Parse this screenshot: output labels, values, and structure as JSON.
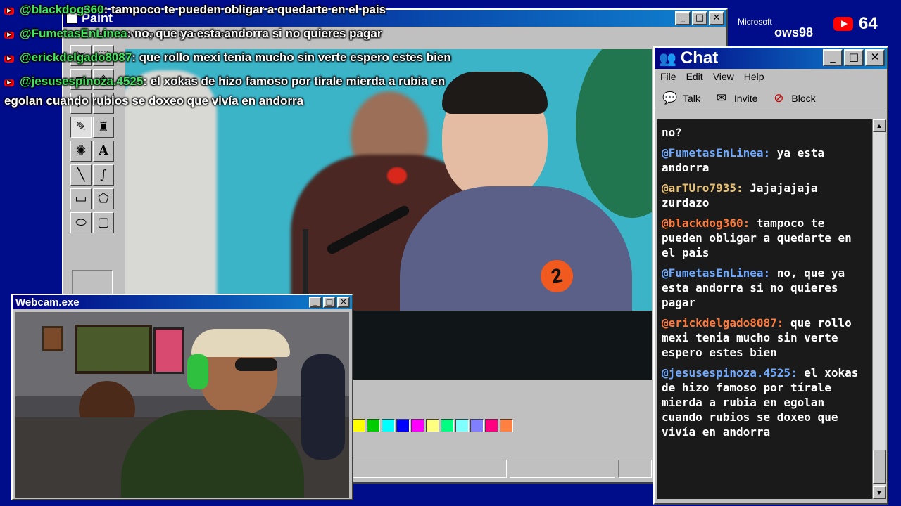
{
  "paint": {
    "title": "Paint",
    "menu": [
      "File",
      "Edit",
      "View",
      "Image",
      "Colors",
      "Help"
    ],
    "palette": [
      "#ffff00",
      "#00cc00",
      "#00ffff",
      "#0000ff",
      "#ff00ff",
      "#ffff80",
      "#00ff80",
      "#80ffff",
      "#8080ff",
      "#ff0080",
      "#ff8040"
    ]
  },
  "chat": {
    "title": "Chat",
    "menu": [
      "File",
      "Edit",
      "View",
      "Help"
    ],
    "tools": {
      "talk": "Talk",
      "invite": "Invite",
      "block": "Block"
    },
    "messages": [
      {
        "user": "",
        "text": "no?",
        "color": "#ffffff"
      },
      {
        "user": "@FumetasEnLinea:",
        "text": " ya esta andorra",
        "color": "#6fa8ff"
      },
      {
        "user": "@arTUro7935:",
        "text": " Jajajajaja zurdazo",
        "color": "#e8c070"
      },
      {
        "user": "@blackdog360:",
        "text": " tampoco te pueden obligar a quedarte en el pais",
        "color": "#ff7a3a"
      },
      {
        "user": "@FumetasEnLinea:",
        "text": " no, que ya esta andorra si no quieres pagar",
        "color": "#6fa8ff"
      },
      {
        "user": "@erickdelgado8087:",
        "text": " que rollo mexi tenia mucho sin verte espero estes bien",
        "color": "#ff7a3a"
      },
      {
        "user": "@jesusespinoza.4525:",
        "text": " el xokas de hizo famoso por tírale mierda a rubia en egolan cuando rubios se doxeo que vivía en andorra",
        "color": "#6fa8ff"
      }
    ]
  },
  "webcam": {
    "title": "Webcam.exe"
  },
  "overlay": {
    "lines": [
      {
        "user": "@blackdog360",
        "text": ": tampoco te pueden obligar a quedarte en el pais"
      },
      {
        "user": "@FumetasEnLinea",
        "text": ": no, que ya esta andorra si no quieres pagar"
      },
      {
        "user": "@erickdelgado8087",
        "text": ": que rollo mexi tenia mucho sin verte espero estes bien"
      },
      {
        "user": "@jesusespinoza.4525",
        "text": ": el xokas de hizo famoso por tírale mierda a rubia en"
      }
    ],
    "wrap": "egolan cuando rubios se doxeo que vivía en andorra"
  },
  "branding": {
    "microsoft": "Microsoft",
    "windows": "ows98"
  },
  "viewers": {
    "count": "64"
  }
}
